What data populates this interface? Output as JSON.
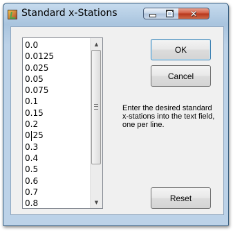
{
  "window": {
    "title": "Standard x-Stations",
    "controls": {
      "minimize": "minimize-icon",
      "maximize": "maximize-icon",
      "close": "close-icon"
    }
  },
  "stations_field": {
    "lines": [
      "0.0",
      "0.0125",
      "0.025",
      "0.05",
      "0.075",
      "0.1",
      "0.15",
      "0.2",
      "0.25",
      "0.3",
      "0.4",
      "0.5",
      "0.6",
      "0.7",
      "0.8"
    ]
  },
  "buttons": {
    "ok": "OK",
    "cancel": "Cancel",
    "reset": "Reset"
  },
  "hint": "Enter the desired standard x-stations into the text field, one per line.",
  "colors": {
    "title_bar": "#bcd2e8",
    "close_button": "#c8452b",
    "default_button_border": "#3c7fb1"
  }
}
